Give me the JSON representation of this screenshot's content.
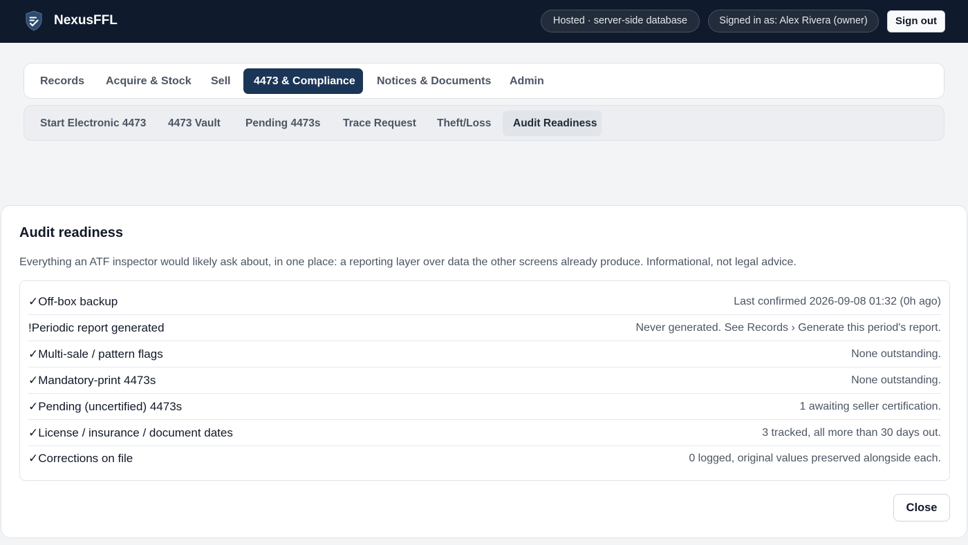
{
  "app": {
    "name": "NexusFFL",
    "logo_icon": "shield-check-icon",
    "hosting_badge": "Hosted · server-side database",
    "signed_in_badge": "Signed in as: Alex Rivera (owner)",
    "sign_out_label": "Sign out"
  },
  "colors": {
    "topbar": "#0f1a2c",
    "accent": "#1b3556",
    "page_bg": "#f3f4f6"
  },
  "main_tabs": [
    {
      "label": "Records",
      "active": false
    },
    {
      "label": "Acquire & Stock",
      "active": false
    },
    {
      "label": "Sell",
      "active": false
    },
    {
      "label": "4473 & Compliance",
      "active": true
    },
    {
      "label": "Notices & Documents",
      "active": false
    },
    {
      "label": "Admin",
      "active": false
    }
  ],
  "sub_tabs": [
    {
      "label": "Start Electronic 4473",
      "active": false
    },
    {
      "label": "4473 Vault",
      "active": false
    },
    {
      "label": "Pending 4473s",
      "active": false
    },
    {
      "label": "Trace Request",
      "active": false
    },
    {
      "label": "Theft/Loss",
      "active": false
    },
    {
      "label": "Audit Readiness",
      "active": true
    }
  ],
  "modal": {
    "title": "Audit readiness",
    "description": "Everything an ATF inspector would likely ask about, in one place: a reporting layer over data the other screens already produce. Informational, not legal advice.",
    "items": [
      {
        "icon": "✓",
        "label": "Off-box backup",
        "status": "Last confirmed 2026-09-08 01:32 (0h ago)"
      },
      {
        "icon": "!",
        "label": "Periodic report generated",
        "status": "Never generated. See Records › Generate this period's report."
      },
      {
        "icon": "✓",
        "label": "Multi-sale / pattern flags",
        "status": "None outstanding."
      },
      {
        "icon": "✓",
        "label": "Mandatory-print 4473s",
        "status": "None outstanding."
      },
      {
        "icon": "✓",
        "label": "Pending (uncertified) 4473s",
        "status": "1 awaiting seller certification."
      },
      {
        "icon": "✓",
        "label": "License / insurance / document dates",
        "status": "3 tracked, all more than 30 days out."
      },
      {
        "icon": "✓",
        "label": "Corrections on file",
        "status": "0 logged, original values preserved alongside each."
      }
    ],
    "close_label": "Close"
  }
}
